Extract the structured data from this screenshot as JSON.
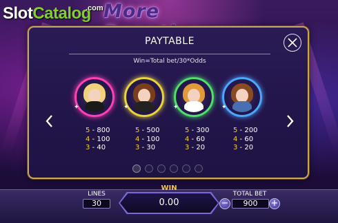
{
  "header": {
    "game_title": "More Beauties",
    "logo_slot": "Slot",
    "logo_catalog": "Catalog",
    "logo_com": ".com"
  },
  "paytable": {
    "title": "PAYTABLE",
    "subtitle": "Win=Total bet/30*Odds",
    "symbols": [
      {
        "name": "bunny-girl",
        "ring_color": "#ff3fb4",
        "hair_color": "#f1d27a",
        "outfit_color": "#1a1a1a",
        "odds": [
          {
            "count": "5",
            "sep": " - ",
            "value": "800"
          },
          {
            "count": "4",
            "sep": " - ",
            "value": "100"
          },
          {
            "count": "3",
            "sep": " - ",
            "value": "40"
          }
        ]
      },
      {
        "name": "maid",
        "ring_color": "#e8d53a",
        "hair_color": "#7a3e1c",
        "outfit_color": "#222222",
        "odds": [
          {
            "count": "5",
            "sep": " - ",
            "value": "500"
          },
          {
            "count": "4",
            "sep": " - ",
            "value": "100"
          },
          {
            "count": "3",
            "sep": " - ",
            "value": "30"
          }
        ]
      },
      {
        "name": "nurse",
        "ring_color": "#4fe06a",
        "hair_color": "#e09a3a",
        "outfit_color": "#ffffff",
        "odds": [
          {
            "count": "5",
            "sep": " - ",
            "value": "300"
          },
          {
            "count": "4",
            "sep": " - ",
            "value": "60"
          },
          {
            "count": "3",
            "sep": " - ",
            "value": "20"
          }
        ]
      },
      {
        "name": "police",
        "ring_color": "#4aa8ff",
        "hair_color": "#8a4a22",
        "outfit_color": "#4a6fb0",
        "odds": [
          {
            "count": "5",
            "sep": " - ",
            "value": "200"
          },
          {
            "count": "4",
            "sep": " - ",
            "value": "60"
          },
          {
            "count": "3",
            "sep": " - ",
            "value": "20"
          }
        ]
      }
    ],
    "page_count": 6,
    "current_page": 1
  },
  "bottom_bar": {
    "lines_label": "LINES",
    "lines_value": "30",
    "win_label": "WIN",
    "win_value": "0.00",
    "total_bet_label": "TOTAL BET",
    "total_bet_value": "900",
    "minus_label": "−",
    "plus_label": "+"
  },
  "colors": {
    "accent_gold": "#f2d23a",
    "panel_border": "#c8a75a"
  }
}
